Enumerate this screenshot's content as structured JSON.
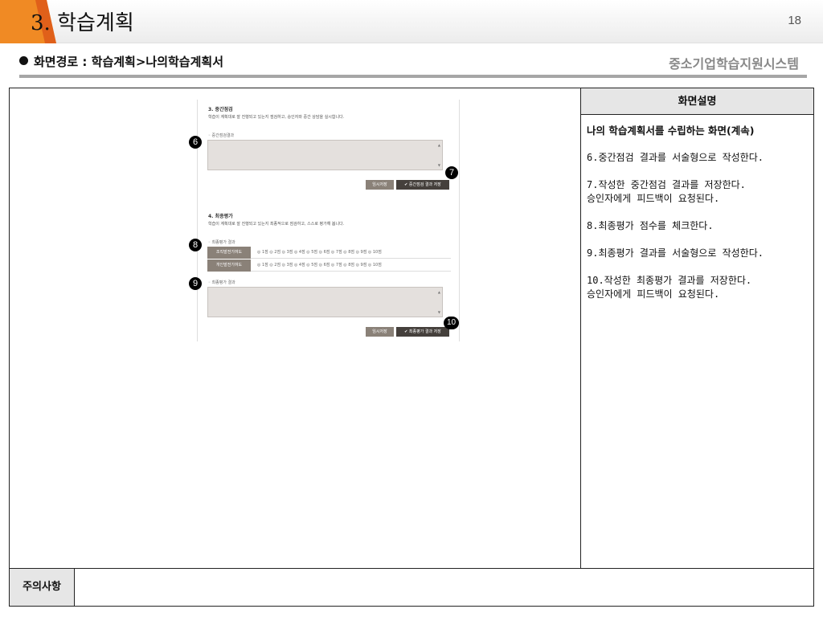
{
  "header": {
    "title": "3. 학습계획",
    "page_number": "18",
    "accent_color": "#f08a24"
  },
  "breadcrumb": {
    "path": "화면경로 : 학습계획>나의학습계획서",
    "system_name": "중소기업학습지원시스템"
  },
  "screen": {
    "midterm": {
      "title": "3. 중간점검",
      "subtitle": "학습이 계획대로 잘 진행되고 있는지 점검하고, 승인자와 중간 상담을 실시합니다.",
      "field_label": "◦ 중간점검결과",
      "temp_save": "임시저장",
      "save_result": "✔ 중간점검 결과 저장"
    },
    "final": {
      "title": "4. 최종평가",
      "subtitle": "학습이 계획대로 잘 진행되고 있는지 최종적으로 점검하고, 스스로 평가해 봅니다.",
      "score_label": "◦ 최종평가 결과",
      "row1_label": "조직발전기여도",
      "row2_label": "개인발전기여도",
      "options": "◎ 1점  ◎ 2점  ◎ 3점  ◎ 4점  ◎ 5점  ◎ 6점  ◎ 7점  ◎ 8점  ◎ 9점  ◎ 10점",
      "field_label": "◦ 최종평가 결과",
      "temp_save": "임시저장",
      "save_result": "✔ 최종평가 결과 저장"
    },
    "markers": [
      "6",
      "7",
      "8",
      "9",
      "10"
    ]
  },
  "description": {
    "heading": "화면설명",
    "lead": "나의 학습계획서를 수립하는 화면(계속)",
    "items": [
      "6.중간점검 결과를 서술형으로 작성한다.",
      "7.작성한 중간점검 결과를 저장한다.\n 승인자에게 피드백이 요청된다.",
      "8.최종평가 점수를 체크한다.",
      "9.최종평가 결과를 서술형으로 작성한다.",
      "10.작성한 최종평가 결과를 저장한다.\n 승인자에게 피드백이 요청된다."
    ]
  },
  "notes": {
    "label": "주의사항",
    "content": ""
  }
}
